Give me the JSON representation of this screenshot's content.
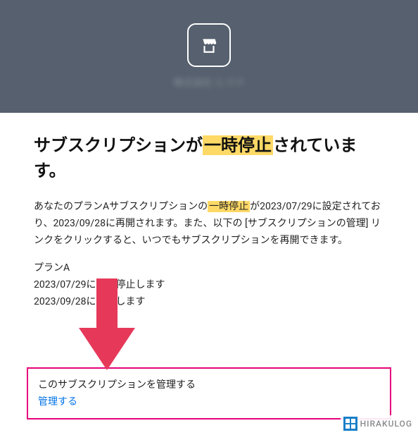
{
  "header": {
    "blurred_text": "株式会社 ヒラク"
  },
  "title": {
    "prefix": "サブスクリプションが",
    "highlighted": "一時停止",
    "suffix": "されています。"
  },
  "description": {
    "part1": "あなたのプランAサブスクリプションの",
    "highlighted": "一時停止",
    "part2": "が2023/07/29に設定されており、2023/09/28に再開されます。また、以下の [サブスクリプションの管理] リンクをクリックすると、いつでもサブスクリプションを再開できます。"
  },
  "plan": {
    "name": "プランA",
    "pause_line_prefix": "2023/07/29",
    "pause_line_mid": "に一時停止",
    "pause_line_suffix": "します",
    "resume_line_prefix": "2023/09/28",
    "resume_line_mid": "に再開し",
    "resume_line_suffix": "ます"
  },
  "manage": {
    "title": "このサブスクリプションを管理する",
    "link": "管理する"
  },
  "watermark": {
    "text": "HIRAKULOG"
  }
}
